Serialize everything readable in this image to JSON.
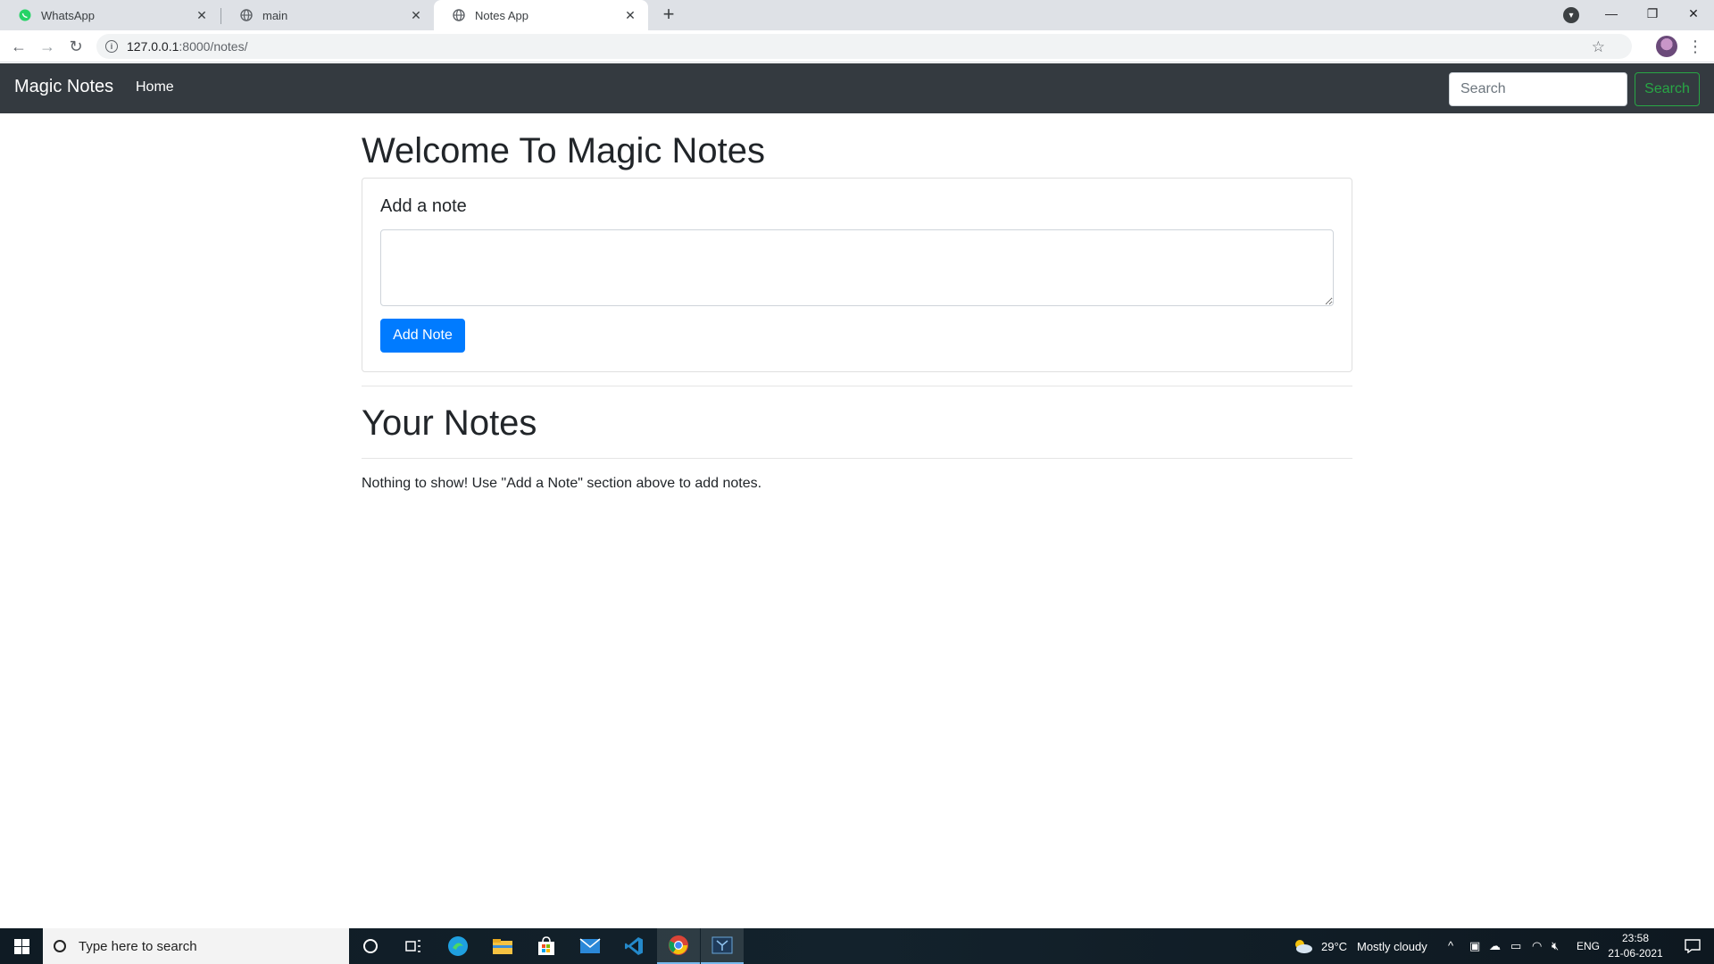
{
  "browser": {
    "tabs": [
      {
        "label": "WhatsApp",
        "favicon": "whatsapp-icon"
      },
      {
        "label": "main",
        "favicon": "globe-icon"
      },
      {
        "label": "Notes App",
        "favicon": "globe-icon",
        "active": true
      }
    ],
    "url_host": "127.0.0.1",
    "url_path": ":8000/notes/"
  },
  "navbar": {
    "brand": "Magic Notes",
    "home": "Home",
    "search_placeholder": "Search",
    "search_button": "Search"
  },
  "main": {
    "welcome_heading": "Welcome To Magic Notes",
    "add_note_title": "Add a note",
    "add_note_button": "Add Note",
    "your_notes_heading": "Your Notes",
    "empty_message": "Nothing to show! Use \"Add a Note\" section above to add notes."
  },
  "taskbar": {
    "search_placeholder": "Type here to search",
    "weather_temp": "29°C",
    "weather_desc": "Mostly cloudy",
    "language": "ENG",
    "time": "23:58",
    "date": "21-06-2021"
  },
  "colors": {
    "navbar_bg": "#343a40",
    "primary": "#007bff",
    "success": "#28a745"
  }
}
